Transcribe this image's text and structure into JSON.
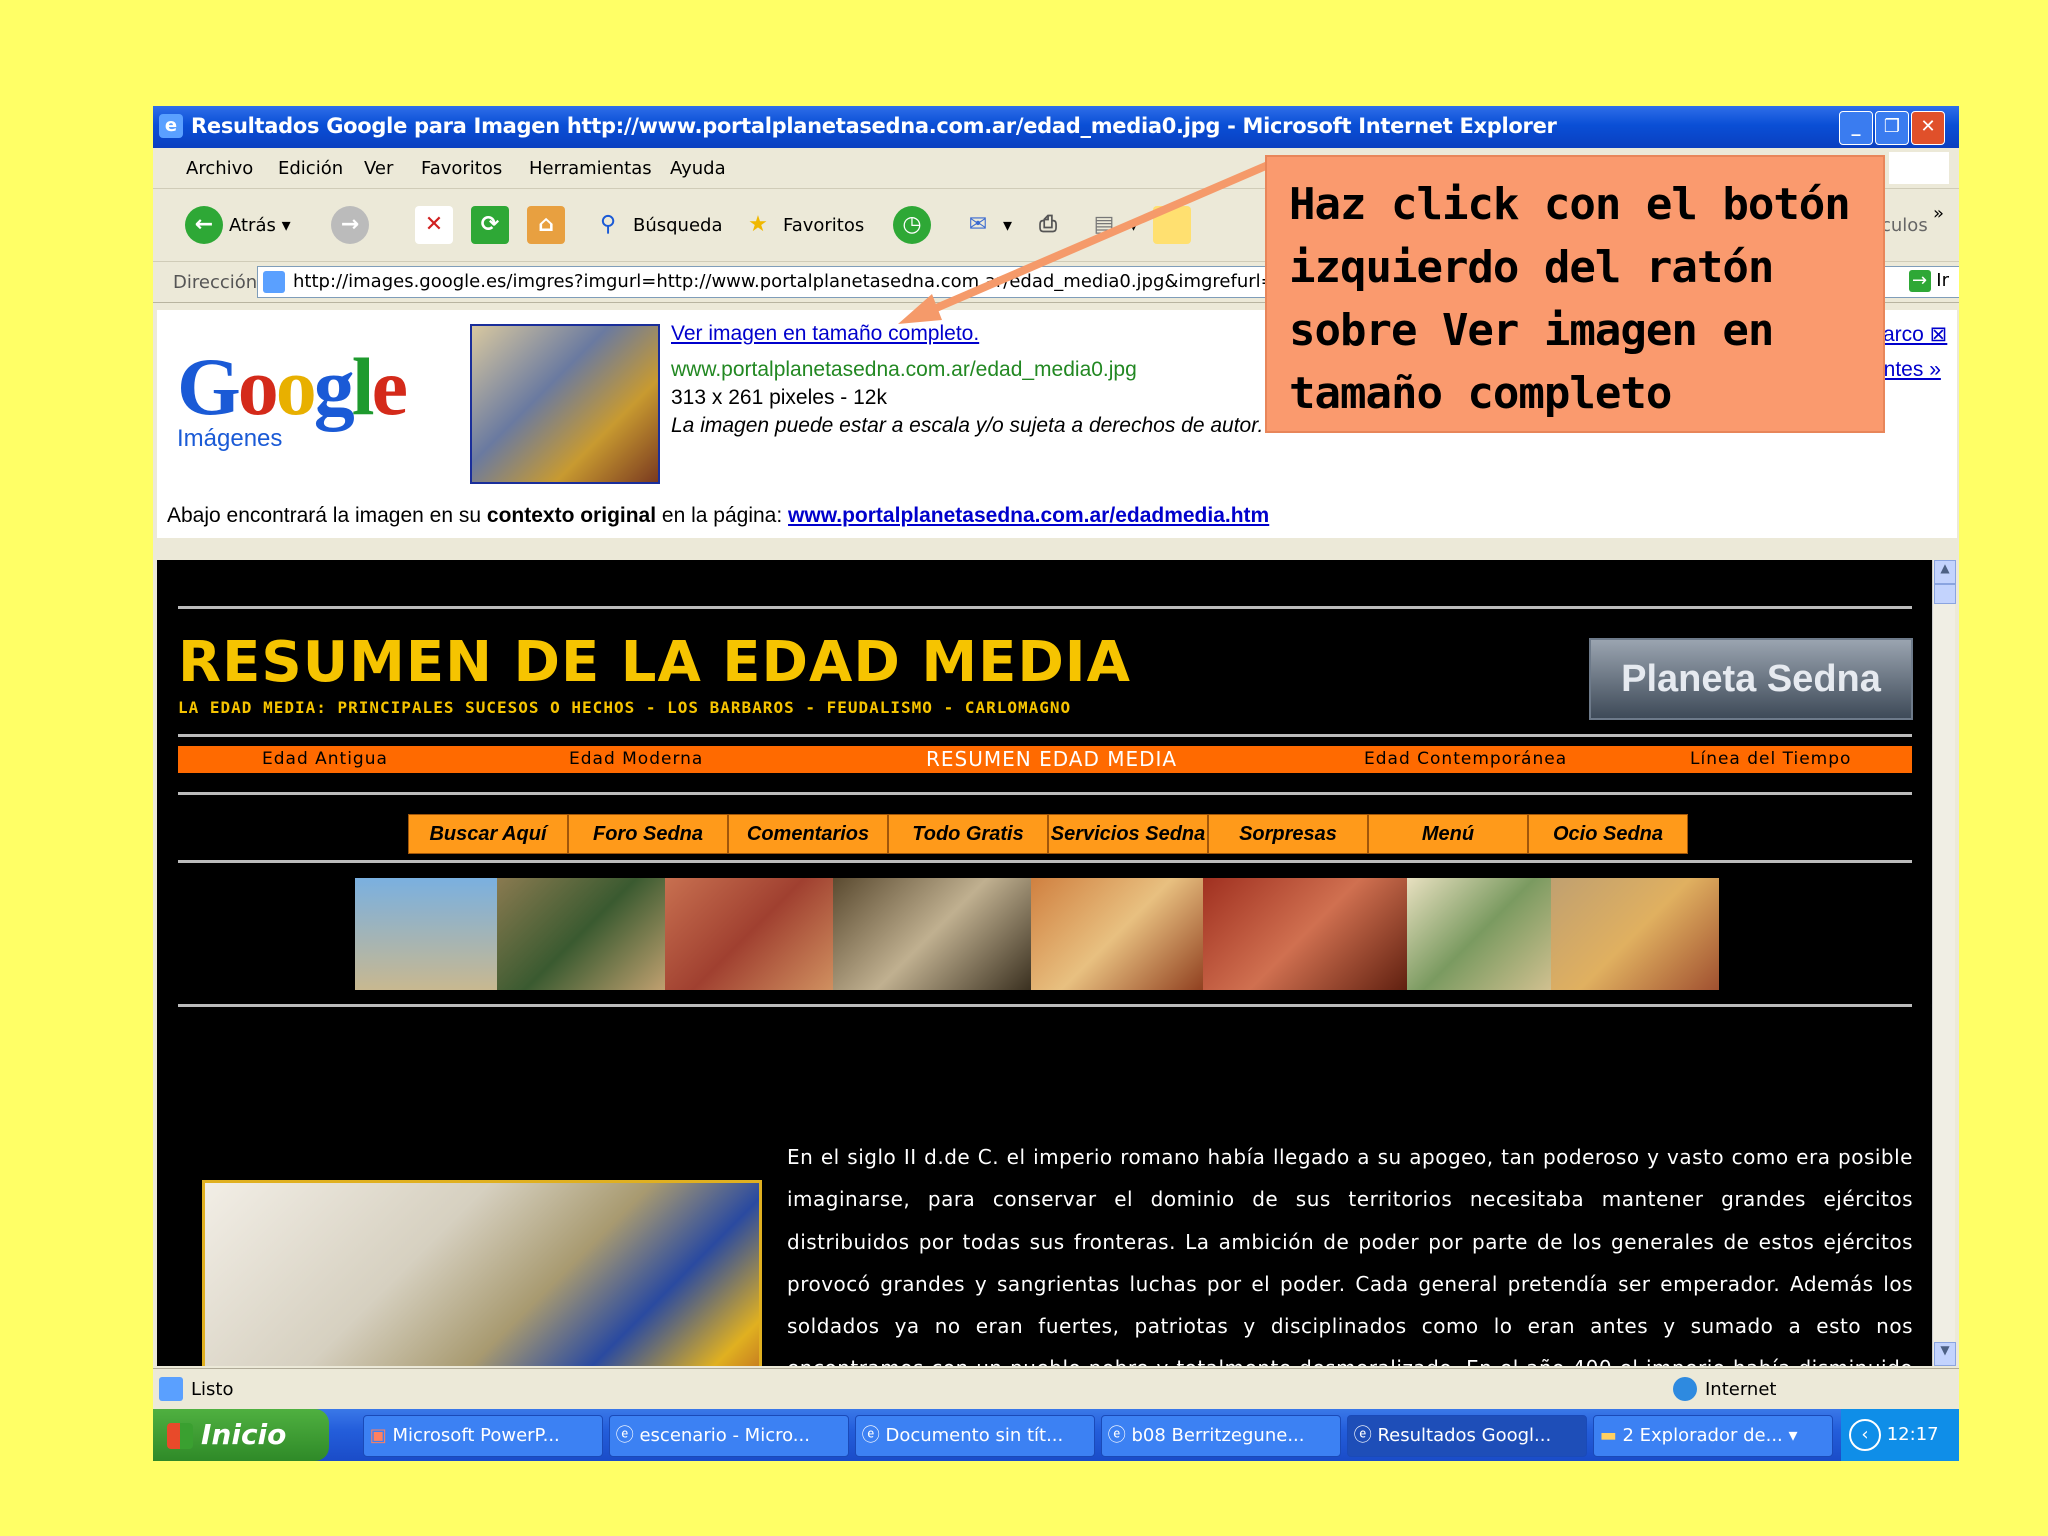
{
  "window": {
    "title": "Resultados Google para Imagen http://www.portalplanetasedna.com.ar/edad_media0.jpg - Microsoft Internet Explorer",
    "buttons": {
      "minimize": "_",
      "maximize": "❐",
      "close": "✕"
    }
  },
  "menubar": [
    "Archivo",
    "Edición",
    "Ver",
    "Favoritos",
    "Herramientas",
    "Ayuda"
  ],
  "toolbar": {
    "back": "Atrás",
    "search": "Búsqueda",
    "favorites": "Favoritos",
    "overflow_label": "culos",
    "more": "»"
  },
  "address": {
    "label": "Dirección",
    "url": "http://images.google.es/imgres?imgurl=http://www.portalplanetasedna.com.ar/edad_media0.jpg&imgrefurl=http:",
    "go": "Ir"
  },
  "google_header": {
    "logo": "Google",
    "logo_sub": "Imágenes",
    "link_full": "Ver imagen en tamaño completo.",
    "image_url": "www.portalplanetasedna.com.ar/edad_media0.jpg",
    "size": "313 x 261 pixeles - 12k",
    "notice": "La imagen puede estar a escala y/o sujeta a derechos de autor.",
    "right_link1": "arco ⊠",
    "right_link2": "intes »",
    "context_prefix": "Abajo encontrará la imagen en su",
    "context_bold": "contexto original",
    "context_mid": "en la página:",
    "context_link": "www.portalplanetasedna.com.ar/edadmedia.htm"
  },
  "page": {
    "title": "RESUMEN DE LA EDAD MEDIA",
    "subtitle": "LA EDAD MEDIA: PRINCIPALES SUCESOS O HECHOS - LOS BARBAROS - FEUDALISMO - CARLOMAGNO",
    "brand_button": "Planeta Sedna",
    "nav": [
      "Edad Antigua",
      "Edad Moderna",
      "RESUMEN EDAD MEDIA",
      "Edad Contemporánea",
      "Línea del Tiempo"
    ],
    "menu": [
      "Buscar Aquí",
      "Foro Sedna",
      "Comentarios",
      "Todo Gratis",
      "Servicios Sedna",
      "Sorpresas",
      "Menú",
      "Ocio Sedna"
    ],
    "body_text": "En el siglo II d.de C. el imperio romano había llegado a su apogeo, tan poderoso y vasto como era posible imaginarse, para conservar el dominio de sus territorios necesitaba mantener grandes ejércitos distribuidos por todas sus fronteras. La ambición de poder por parte de los generales de estos ejércitos provocó grandes y sangrientas luchas por el poder. Cada general pretendía ser emperador. Además los soldados ya no eran fuertes, patriotas y disciplinados como lo eran antes y sumado a esto nos encontramos con un pueblo pobre y totalmente desmoralizado. En el año 400 el imperio había disminuido drásticamente, no se conocen las causas, pero podría ser por plagas y por el consumo de agua que circulaba por conductos de"
  },
  "status": {
    "left": "Listo",
    "zone": "Internet"
  },
  "taskbar": {
    "start": "Inicio",
    "items": [
      "Microsoft PowerP...",
      "escenario - Micro...",
      "Documento sin tít...",
      "b08 Berritzegune...",
      "Resultados Googl...",
      "2 Explorador de..."
    ],
    "clock": "12:17"
  },
  "callout": {
    "text": "Haz click con el botón izquierdo del ratón sobre Ver imagen en tamaño completo"
  },
  "colors": {
    "background": "#ffff66",
    "callout": "#fa9a6e",
    "page_title": "#f6c400",
    "nav_orange": "#ff6a00"
  }
}
